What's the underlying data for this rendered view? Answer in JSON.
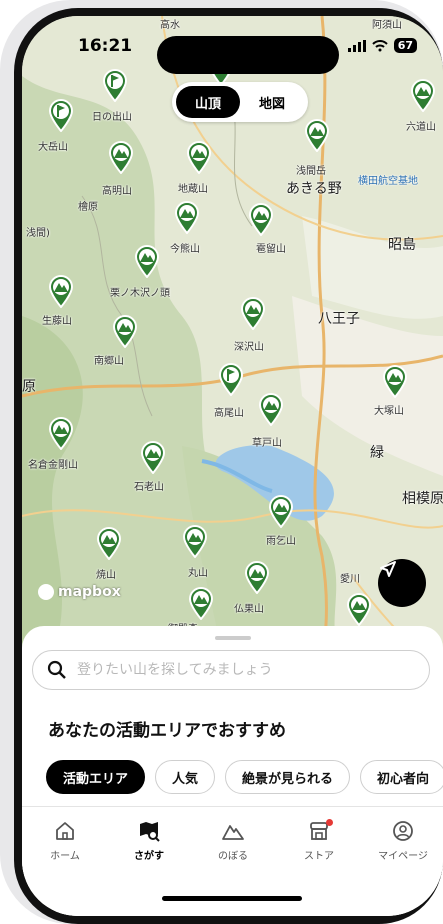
{
  "status_bar": {
    "time": "16:21",
    "battery": "67"
  },
  "map_toggle": {
    "mountain": "山頂",
    "map": "地図"
  },
  "map_labels": {
    "hinode": "日の出山",
    "odake": "大岳山",
    "takaaki": "高明山",
    "jizo": "地蔵山",
    "asama": "浅間岳",
    "akiruno": "あきる野",
    "yokota": "横田航空基地",
    "rokudo": "六道山",
    "hinohara": "檜原",
    "sengen": "浅間)",
    "imakuma": "今熊山",
    "kanmuri": "雹留山",
    "akishima": "昭島",
    "kurinoki": "栗ノ木沢ノ頭",
    "ikusa": "生藤山",
    "hachioji": "八王子",
    "fukasawa": "深沢山",
    "nango": "南郷山",
    "takao": "高尾山",
    "otsuka": "大塚山",
    "hara": "原",
    "kusato": "草戸山",
    "midori": "緑",
    "nakonkongo": "名倉金剛山",
    "ishiro": "石老山",
    "sagami": "相模原",
    "amagoi": "雨乞山",
    "yake": "焼山",
    "maru": "丸山",
    "aikawa": "愛川",
    "butsuka": "仏果山",
    "top1": "高水",
    "top2": "阿須山",
    "bottom": "御殿森"
  },
  "attribution": "mapbox",
  "search": {
    "placeholder": "登りたい山を探してみましょう"
  },
  "section_title": "あなたの活動エリアでおすすめ",
  "chips": [
    "活動エリア",
    "人気",
    "絶景が見られる",
    "初心者向"
  ],
  "tabs": [
    {
      "label": "ホーム",
      "icon": "home-icon"
    },
    {
      "label": "さがす",
      "icon": "map-search-icon"
    },
    {
      "label": "のぼる",
      "icon": "mountain-icon"
    },
    {
      "label": "ストア",
      "icon": "store-icon"
    },
    {
      "label": "マイページ",
      "icon": "user-icon"
    }
  ],
  "colors": {
    "pin": "#2e7d32",
    "water": "#7fb8e6",
    "accent": "#000000",
    "notify": "#e53935"
  }
}
